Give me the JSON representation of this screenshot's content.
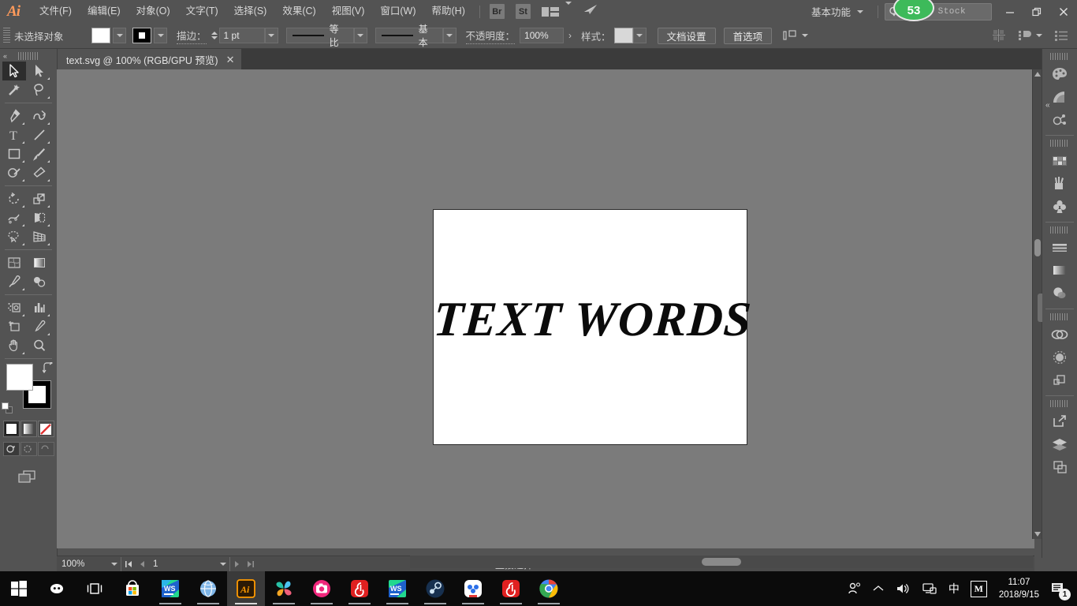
{
  "app": {
    "logo": "Ai",
    "menus": [
      {
        "label": "文件(F)"
      },
      {
        "label": "编辑(E)"
      },
      {
        "label": "对象(O)"
      },
      {
        "label": "文字(T)"
      },
      {
        "label": "选择(S)"
      },
      {
        "label": "效果(C)"
      },
      {
        "label": "视图(V)"
      },
      {
        "label": "窗口(W)"
      },
      {
        "label": "帮助(H)"
      }
    ],
    "bridge_chip": "Br",
    "stock_chip": "St",
    "workspace": "基本功能",
    "stock_search_placeholder": "Adobe Stock",
    "fps_badge": "53",
    "window_buttons": {
      "minimize": "—",
      "restore": "❐",
      "close": "✕"
    }
  },
  "control_bar": {
    "selection_label": "未选择对象",
    "fill_color": "#ffffff",
    "stroke_color": "#000000",
    "stroke_label": "描边：",
    "stroke_weight": "1 pt",
    "profile_label": "等比",
    "brush_label": "基本",
    "opacity_label": "不透明度：",
    "opacity_value": "100%",
    "style_label": "样式：",
    "style_color": "#d8d8d8",
    "doc_setup_button": "文档设置",
    "preferences_button": "首选项"
  },
  "document": {
    "tab_title": "text.svg @ 100% (RGB/GPU 预览)",
    "close_label": "✕"
  },
  "toolbar": {
    "tools": [
      {
        "name": "selection-tool",
        "label": "选择工具",
        "active": true
      },
      {
        "name": "direct-selection-tool",
        "label": "直接选择工具",
        "active": false
      },
      {
        "name": "magic-wand-tool",
        "label": "魔棒工具",
        "active": false
      },
      {
        "name": "lasso-tool",
        "label": "套索工具",
        "active": false
      },
      {
        "name": "pen-tool",
        "label": "钢笔工具",
        "active": false
      },
      {
        "name": "curvature-tool",
        "label": "曲率工具",
        "active": false
      },
      {
        "name": "type-tool",
        "label": "文字工具",
        "active": false
      },
      {
        "name": "line-segment-tool",
        "label": "直线段工具",
        "active": false
      },
      {
        "name": "rectangle-tool",
        "label": "矩形工具",
        "active": false
      },
      {
        "name": "paintbrush-tool",
        "label": "画笔工具",
        "active": false
      },
      {
        "name": "shaper-tool",
        "label": "Shaper 工具",
        "active": false
      },
      {
        "name": "eraser-tool",
        "label": "橡皮擦工具",
        "active": false
      },
      {
        "name": "rotate-tool",
        "label": "旋转工具",
        "active": false
      },
      {
        "name": "scale-tool",
        "label": "比例缩放工具",
        "active": false
      },
      {
        "name": "width-tool",
        "label": "宽度工具",
        "active": false
      },
      {
        "name": "free-transform-tool",
        "label": "自由变换工具",
        "active": false
      },
      {
        "name": "shape-builder-tool",
        "label": "形状生成器工具",
        "active": false
      },
      {
        "name": "perspective-grid-tool",
        "label": "透视网格工具",
        "active": false
      },
      {
        "name": "mesh-tool",
        "label": "网格工具",
        "active": false
      },
      {
        "name": "gradient-tool",
        "label": "渐变工具",
        "active": false
      },
      {
        "name": "eyedropper-tool",
        "label": "吸管工具",
        "active": false
      },
      {
        "name": "blend-tool",
        "label": "混合工具",
        "active": false
      },
      {
        "name": "symbol-sprayer-tool",
        "label": "符号喷枪工具",
        "active": false
      },
      {
        "name": "column-graph-tool",
        "label": "柱形图工具",
        "active": false
      },
      {
        "name": "artboard-tool",
        "label": "画板工具",
        "active": false
      },
      {
        "name": "slice-tool",
        "label": "切片工具",
        "active": false
      },
      {
        "name": "hand-tool",
        "label": "抓手工具",
        "active": false
      },
      {
        "name": "zoom-tool",
        "label": "缩放工具",
        "active": false
      }
    ],
    "fill_color": "#ffffff",
    "stroke_color": "#000000",
    "color_modes": [
      {
        "name": "color-mode",
        "active": true
      },
      {
        "name": "gradient-mode",
        "active": false
      },
      {
        "name": "none-mode",
        "active": false
      }
    ],
    "draw_modes": [
      {
        "name": "draw-normal",
        "active": true
      },
      {
        "name": "draw-behind",
        "active": false
      },
      {
        "name": "draw-inside",
        "active": false
      }
    ]
  },
  "canvas": {
    "artwork_text": "TEXT WORDS",
    "artboard_background": "#ffffff",
    "canvas_background": "#7b7b7b"
  },
  "status_bar": {
    "zoom_level": "100%",
    "artboard_number": "1",
    "status_text": "直接选择"
  },
  "right_dock": {
    "panels": [
      {
        "name": "color-panel",
        "label": "颜色"
      },
      {
        "name": "color-guide-panel",
        "label": "颜色参考"
      },
      {
        "name": "pathfinder-panel",
        "label": "路径查找器"
      },
      {
        "name": "swatches-panel",
        "label": "色板"
      },
      {
        "name": "brushes-panel",
        "label": "画笔"
      },
      {
        "name": "symbols-panel",
        "label": "符号"
      },
      {
        "name": "stroke-panel",
        "label": "描边"
      },
      {
        "name": "gradient-panel",
        "label": "渐变"
      },
      {
        "name": "transparency-panel",
        "label": "透明度"
      },
      {
        "name": "cc-libraries-panel",
        "label": "CC Libraries"
      },
      {
        "name": "appearance-panel",
        "label": "外观"
      },
      {
        "name": "align-panel",
        "label": "对齐"
      },
      {
        "name": "export-panel",
        "label": "导出"
      },
      {
        "name": "layers-panel",
        "label": "图层"
      },
      {
        "name": "artboards-panel",
        "label": "画板"
      }
    ]
  },
  "taskbar": {
    "items": [
      {
        "name": "start-button",
        "label": "开始"
      },
      {
        "name": "cortana-button",
        "label": "Cortana"
      },
      {
        "name": "task-view-button",
        "label": "任务视图"
      },
      {
        "name": "microsoft-store",
        "label": "Microsoft Store"
      },
      {
        "name": "webstorm-app",
        "label": "WebStorm"
      },
      {
        "name": "browser-app",
        "label": "浏览器"
      },
      {
        "name": "illustrator-app",
        "label": "Adobe Illustrator"
      },
      {
        "name": "photo-app",
        "label": "图片应用"
      },
      {
        "name": "camera-app",
        "label": "相机应用"
      },
      {
        "name": "music-app",
        "label": "音乐"
      },
      {
        "name": "webstorm-window",
        "label": "WebStorm"
      },
      {
        "name": "steam-app",
        "label": "Steam"
      },
      {
        "name": "baidu-netdisk-app",
        "label": "百度网盘"
      },
      {
        "name": "netease-music-app",
        "label": "网易云音乐"
      },
      {
        "name": "chrome-app",
        "label": "Google Chrome"
      }
    ],
    "tray": {
      "people": "人脉",
      "chevron": "︿",
      "volume": "音量",
      "network": "网络",
      "ime": "中",
      "ime_m": "M",
      "time": "11:07",
      "date": "2018/9/15",
      "notification_count": "1"
    }
  }
}
